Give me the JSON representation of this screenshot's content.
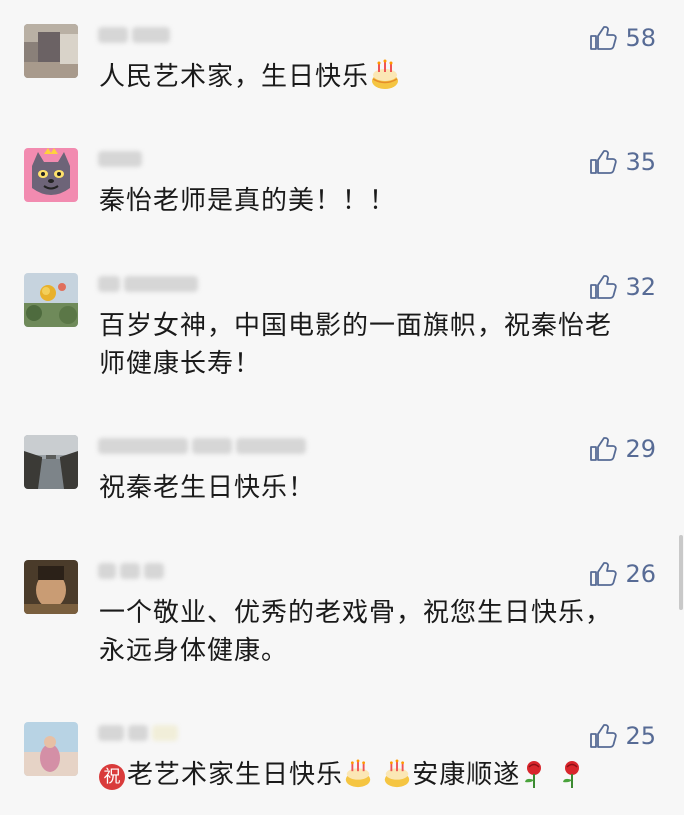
{
  "colors": {
    "background": "#f7f7f7",
    "link_blue": "#576b95",
    "text": "#1a1a1a"
  },
  "comments": [
    {
      "avatar": "blurred-photo-avatar",
      "nickname_visible": false,
      "text": "人民艺术家，生日快乐",
      "emojis": [
        "birthday-cake-emoji"
      ],
      "likes": "58"
    },
    {
      "avatar": "cartoon-wolf-avatar",
      "nickname_visible": false,
      "text": "秦怡老师是真的美！！！",
      "emojis": [],
      "likes": "35"
    },
    {
      "avatar": "yellow-flower-avatar",
      "nickname_visible": false,
      "text_line1": "百岁女神，中国电影的一面旗帜，祝秦怡老",
      "text_line2": "师健康长寿！",
      "emojis": [],
      "likes": "32"
    },
    {
      "avatar": "canal-landscape-avatar",
      "nickname_visible": false,
      "text": "祝秦老生日快乐！",
      "emojis": [],
      "likes": "29"
    },
    {
      "avatar": "blurred-portrait-avatar",
      "nickname_visible": false,
      "text_line1": "一个敬业、优秀的老戏骨，祝您生日快乐，",
      "text_line2": "永远身体健康。",
      "emojis": [],
      "likes": "26"
    },
    {
      "avatar": "blurred-seaside-avatar",
      "nickname_visible": false,
      "zhu_char": "祝",
      "text_part1": "老艺术家生日快乐",
      "text_part2": "安康顺遂",
      "emojis": [
        "zhu-emoji",
        "birthday-cake-emoji",
        "birthday-cake-emoji",
        "rose-emoji",
        "rose-emoji"
      ],
      "likes": "25"
    }
  ]
}
